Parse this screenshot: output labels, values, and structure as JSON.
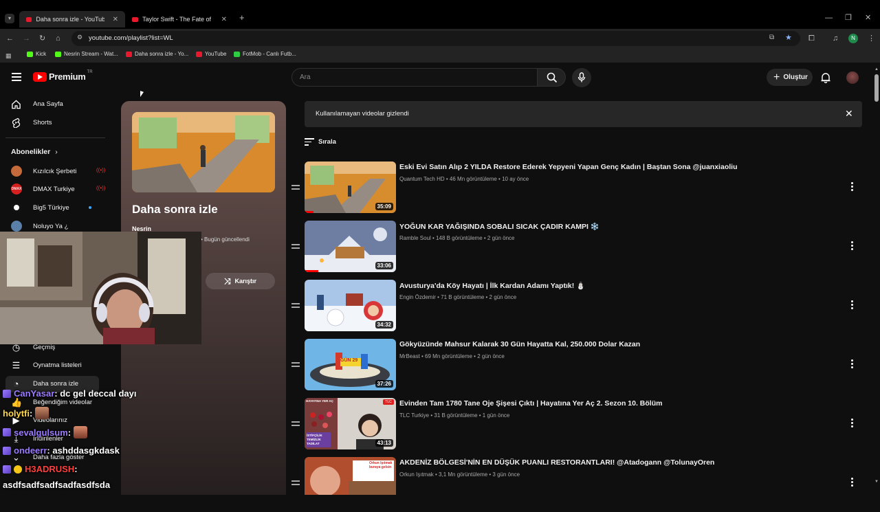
{
  "browser": {
    "tabs": [
      {
        "label": "Daha sonra izle - YouTube"
      },
      {
        "label": "Taylor Swift - The Fate of Ophel"
      }
    ],
    "new_tab": "+",
    "url": "youtube.com/playlist?list=WL",
    "bookmarks": [
      {
        "label": "Kick",
        "color": "#53fc18"
      },
      {
        "label": "Nesrin Stream - Wat...",
        "color": "#53fc18"
      },
      {
        "label": "Daha sonra izle - Yo...",
        "color": "#e8192c"
      },
      {
        "label": "YouTube",
        "color": "#e8192c"
      },
      {
        "label": "FotMob - Canlı Futb...",
        "color": "#2ecc40"
      }
    ],
    "profile_letter": "N"
  },
  "header": {
    "logo_text": "Premium",
    "region": "TR",
    "search_placeholder": "Ara",
    "create_label": "Oluştur"
  },
  "sidebar": {
    "top": [
      {
        "label": "Ana Sayfa",
        "icon": "home-icon"
      },
      {
        "label": "Shorts",
        "icon": "shorts-icon"
      }
    ],
    "subscriptions_title": "Abonelikler",
    "channels": [
      {
        "label": "Kızılcık Şerbeti",
        "color": "#c56a3a",
        "live": true
      },
      {
        "label": "DMAX Turkiye",
        "color": "#d62020",
        "live": true
      },
      {
        "label": "Big5 Türkiye",
        "color": "#ffffff",
        "live": false,
        "dot": true
      },
      {
        "label": "Noluyo Ya ¿",
        "color": "#5a7fa8",
        "live": false
      }
    ],
    "you_items": [
      {
        "label": "Geçmiş",
        "icon": "history-icon"
      },
      {
        "label": "Oynatma listeleri",
        "icon": "playlists-icon"
      },
      {
        "label": "Daha sonra izle",
        "icon": "watch-later-icon"
      },
      {
        "label": "Beğendiğim videolar",
        "icon": "like-icon"
      },
      {
        "label": "Videolarınız",
        "icon": "your-videos-icon"
      },
      {
        "label": "İndirilenler",
        "icon": "download-icon"
      },
      {
        "label": "Daha fazla göster",
        "icon": "chevron-down-icon"
      }
    ]
  },
  "playlist": {
    "title": "Daha sonra izle",
    "owner": "Nesrin",
    "updated": "Bugün güncellendi",
    "shuffle_label": "Karıştır"
  },
  "banner": {
    "text": "Kullanılamayan videolar gizlendi"
  },
  "sort_label": "Sırala",
  "videos": [
    {
      "title": "Eski Evi Satın Alıp 2 YILDA Restore Ederek Yepyeni Yapan Genç Kadın | Baştan Sona @juanxiaoliu",
      "meta": "Quantum Tech HD • 46 Mn görüntüleme • 10 ay önce",
      "duration": "35:09",
      "progress": 0.1
    },
    {
      "title": "YOĞUN KAR YAĞIŞINDA SOBALI SICAK ÇADIR KAMPI ❄️",
      "meta": "Ramble Soul • 148 B görüntüleme • 2 gün önce",
      "duration": "33:06",
      "progress": 0.15
    },
    {
      "title": "Avusturya'da Köy Hayatı | İlk Kardan Adamı Yaptık! ⛄",
      "meta": "Engin Özdemir • 71 B görüntüleme • 2 gün önce",
      "duration": "34:32",
      "progress": 0.0
    },
    {
      "title": "Gökyüzünde Mahsur Kalarak 30 Gün Hayatta Kal, 250.000 Dolar Kazan",
      "meta": "MrBeast • 69 Mn görüntüleme • 2 gün önce",
      "duration": "37:26",
      "progress": 0.0
    },
    {
      "title": "Evinden Tam 1780 Tane Oje Şişesi Çıktı | Hayatına Yer Aç 2. Sezon 10. Bölüm",
      "meta": "TLC Turkiye • 31 B görüntüleme • 1 gün önce",
      "duration": "43:13",
      "progress": 0.0
    },
    {
      "title": "AKDENİZ BÖLGESİ'NİN EN DÜŞÜK PUANLI RESTORANTLARI! @Atadogann @TolunayOren",
      "meta": "Orkun Işıtmak • 3,1 Mn görüntüleme • 3 gün önce",
      "duration": "",
      "progress": 0.0
    }
  ],
  "thumb_texts": {
    "v4_sign": "GÜN 29",
    "v5_top": "HAYATINA YER AÇ",
    "v5_side": "İSTİFÇİLİK TEMİZLİK TADİLAT",
    "v6_sign": "Orkun Işıtmak buraya gelsin"
  },
  "chat": [
    {
      "user": "CanYasar",
      "user_color": "#9b7bff",
      "text": ": dc gel deccal dayı"
    },
    {
      "user": "holytfi",
      "user_color": "#ffd84d",
      "text": " :"
    },
    {
      "user": "sevalgulsum",
      "user_color": "#9b7bff",
      "text": " :"
    },
    {
      "user": "ondeerr",
      "user_color": "#9b7bff",
      "text": ": ashddasgkdask"
    },
    {
      "user": "H3ADRUSH",
      "user_color": "#ff4040",
      "text": " :"
    },
    {
      "user": "",
      "user_color": "#ffffff",
      "text": "asdfsadfsadfsadfasdfsda"
    }
  ]
}
